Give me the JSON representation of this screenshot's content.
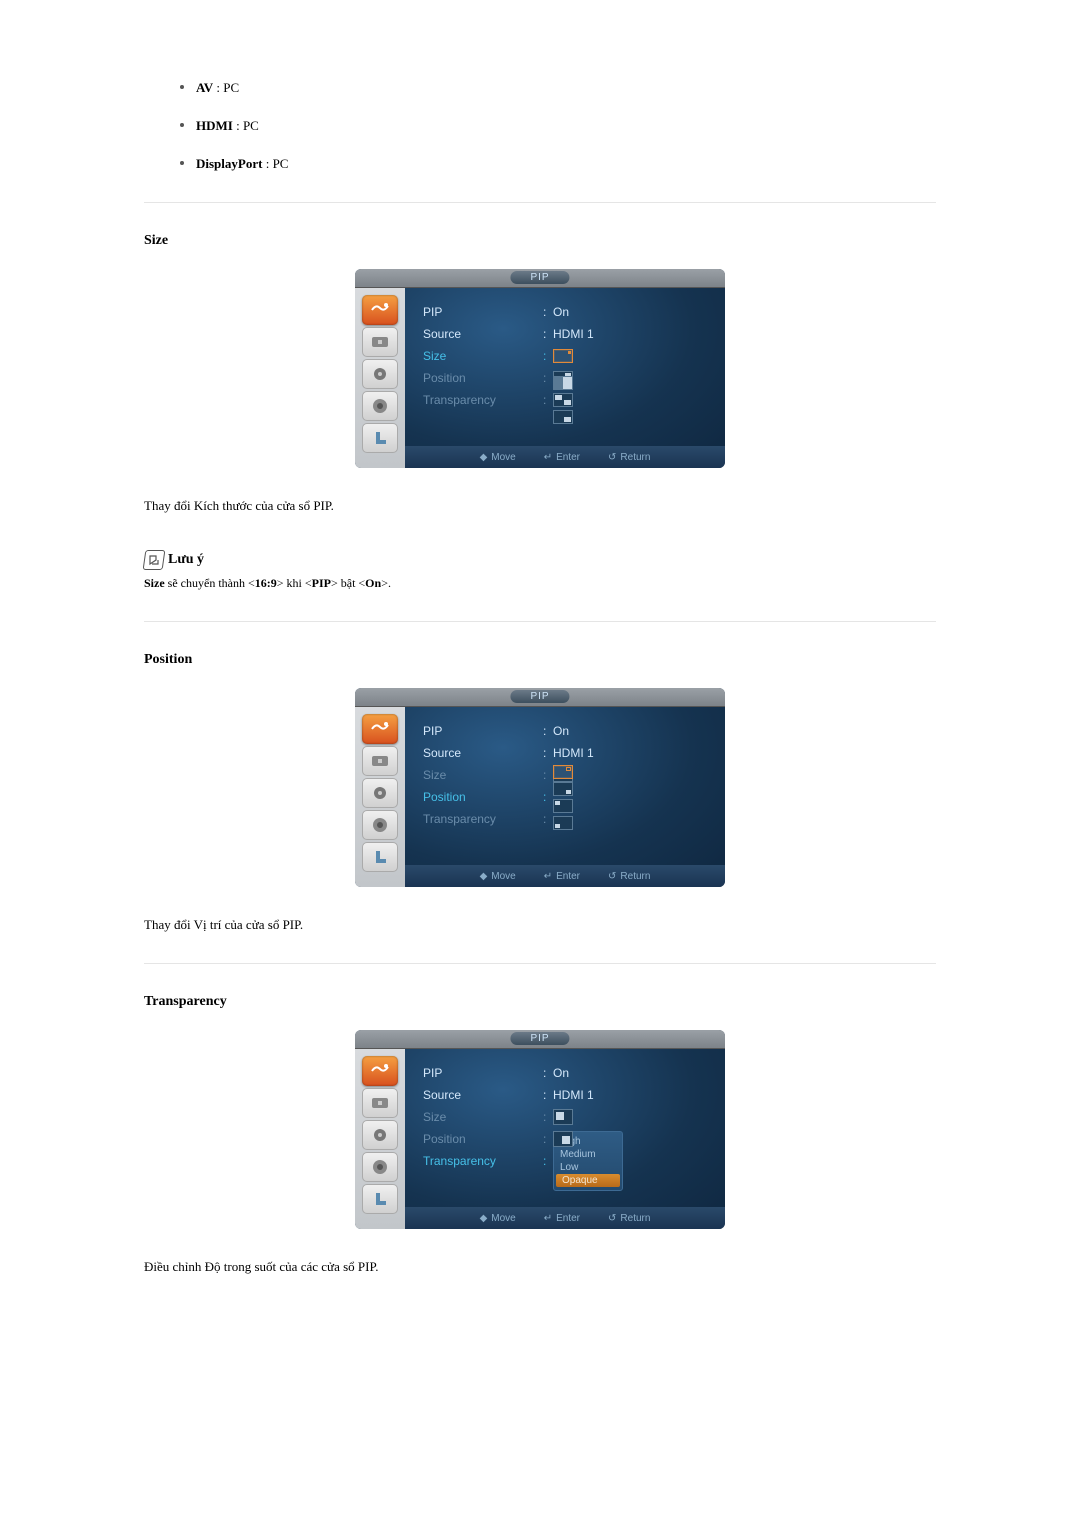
{
  "inputs": [
    {
      "label_bold": "AV",
      "label_rest": " : PC"
    },
    {
      "label_bold": "HDMI",
      "label_rest": " : PC"
    },
    {
      "label_bold": "DisplayPort",
      "label_rest": " : PC"
    }
  ],
  "sections": {
    "size": {
      "title": "Size",
      "desc": "Thay đổi Kích thước của cửa sổ PIP.",
      "note_title": " Lưu ý",
      "note_text_parts": [
        "Size",
        " sẽ chuyển thành <",
        "16:9",
        "> khi <",
        "PIP",
        "> bật <",
        "On",
        ">."
      ]
    },
    "position": {
      "title": "Position",
      "desc": "Thay đổi Vị trí của cửa sổ PIP."
    },
    "transparency": {
      "title": "Transparency",
      "desc": "Điều chỉnh Độ trong suốt của các cửa sổ PIP."
    }
  },
  "osd": {
    "tab": "PIP",
    "labels": {
      "pip": "PIP",
      "source": "Source",
      "size": "Size",
      "position": "Position",
      "transparency": "Transparency"
    },
    "values": {
      "on": "On",
      "hdmi1": "HDMI 1"
    },
    "transparency_options": [
      "High",
      "Medium",
      "Low",
      "Opaque"
    ],
    "transparency_selected": "Opaque",
    "footer": {
      "move": "Move",
      "enter": "Enter",
      "return": "Return"
    }
  }
}
